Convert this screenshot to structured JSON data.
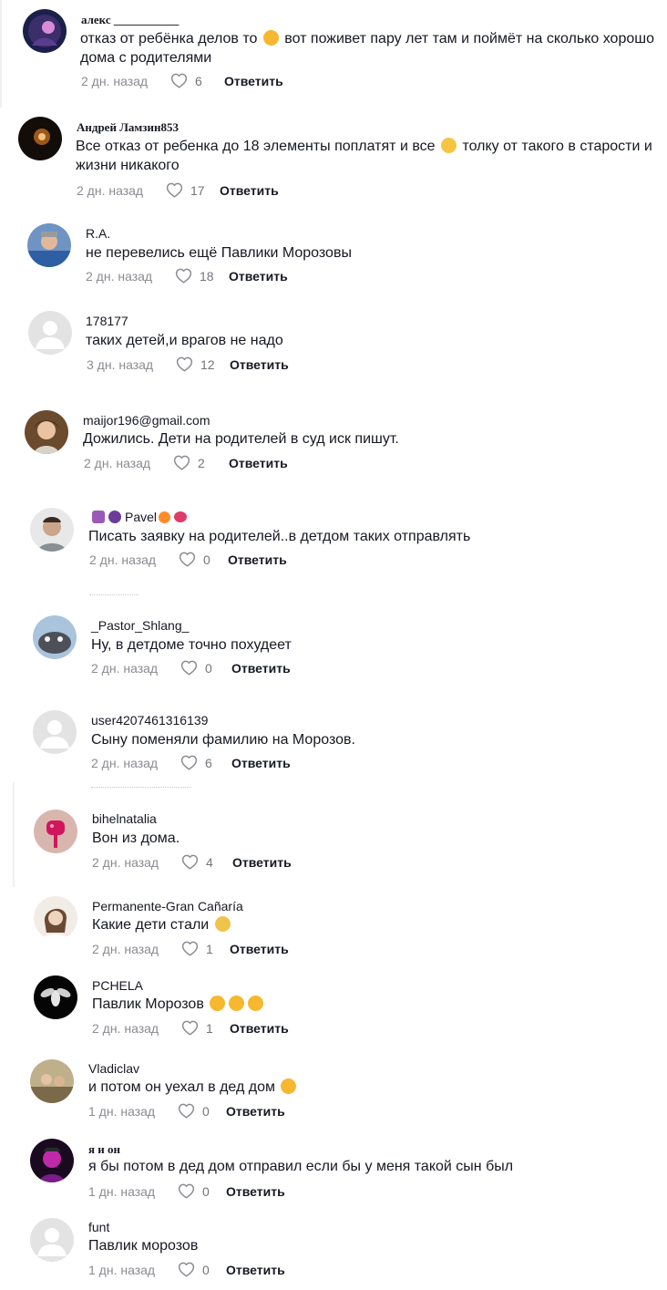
{
  "labels": {
    "reply": "Ответить"
  },
  "colors": {
    "text": "#161823",
    "meta": "#8a8b91",
    "heart_outline": "#8a8b91"
  },
  "comments": [
    {
      "username": "алекс ___________",
      "text_a": "отказ от ребёнка делов то ",
      "emoji_a": "rofl",
      "text_b": " вот поживет пару лет там и поймёт на сколько хорошо дома с родителями",
      "time": "2 дн. назад",
      "likes": "6"
    },
    {
      "username": "Андрей Ламзин853",
      "text_a": "Все отказ от ребенка до 18 элементы поплатят и все ",
      "emoji_a": "winking-face",
      "text_b": " толку от такого в старости и жизни никакого",
      "time": "2 дн. назад",
      "likes": "17"
    },
    {
      "username": "R.A.",
      "text": "не перевелись ещё Павлики Морозовы",
      "time": "2 дн. назад",
      "likes": "18"
    },
    {
      "username": "178177",
      "text": "таких детей,и врагов не надо",
      "time": "3 дн. назад",
      "likes": "12"
    },
    {
      "username": "maijor196@gmail.com",
      "text": "Дожились. Дети на родителей в суд иск пишут.",
      "time": "2 дн. назад",
      "likes": "2"
    },
    {
      "username": "Pavel",
      "username_icons": [
        "purple-heart-box-icon",
        "grapes-icon",
        "orange-heart-icon",
        "lips-icon"
      ],
      "text": "Писать заявку на родителей..в детдом таких отправлять",
      "time": "2 дн. назад",
      "likes": "0"
    },
    {
      "username": "_Pastor_Shlang_",
      "text": "Ну, в детдоме точно похудеет",
      "time": "2 дн. назад",
      "likes": "0"
    },
    {
      "username": "user4207461316139",
      "text": "Сыну поменяли фамилию на Морозов.",
      "time": "2 дн. назад",
      "likes": "6"
    },
    {
      "username": "bihelnatalia",
      "text": "Вон из дома.",
      "time": "2 дн. назад",
      "likes": "4"
    },
    {
      "username": "Permanente-Gran Cañaría",
      "text_a": "Какие дети стали ",
      "emoji_a": "person-facepalming",
      "time": "2 дн. назад",
      "likes": "1"
    },
    {
      "username": "PCHELA",
      "text_a": "Павлик Морозов ",
      "emoji_a": "laughing-tears-x3",
      "time": "2 дн. назад",
      "likes": "1"
    },
    {
      "username": "Vladiclav",
      "text_a": "и потом он уехал в дед дом ",
      "emoji_a": "rofl",
      "time": "1 дн. назад",
      "likes": "0"
    },
    {
      "username": "я и он",
      "text": "я бы потом в дед дом отправил если бы у меня такой сын был",
      "time": "1 дн. назад",
      "likes": "0"
    },
    {
      "username": "funt",
      "text": "Павлик морозов",
      "time": "1 дн. назад",
      "likes": "0"
    }
  ]
}
